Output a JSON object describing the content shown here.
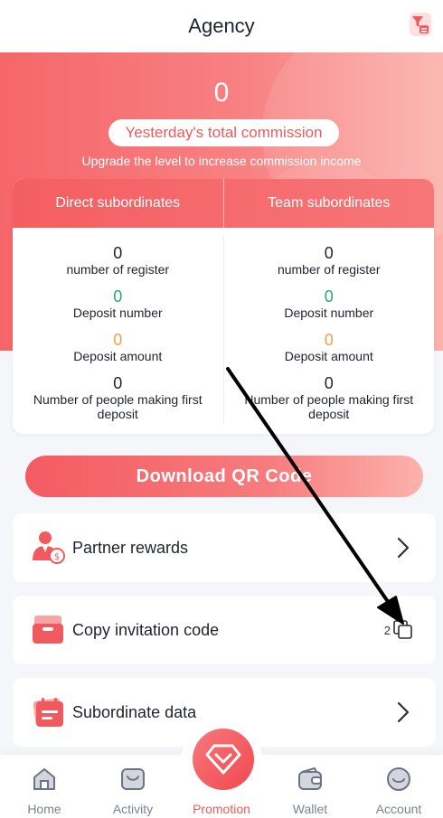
{
  "header": {
    "title": "Agency"
  },
  "hero": {
    "commission_value": "0",
    "commission_label": "Yesterday's total commission",
    "upgrade_text": "Upgrade the level to increase commission income"
  },
  "stats": {
    "direct": {
      "title": "Direct subordinates",
      "register_value": "0",
      "register_label": "number of register",
      "deposit_number_value": "0",
      "deposit_number_label": "Deposit number",
      "deposit_amount_value": "0",
      "deposit_amount_label": "Deposit amount",
      "first_deposit_value": "0",
      "first_deposit_label": "Number of people making first deposit"
    },
    "team": {
      "title": "Team subordinates",
      "register_value": "0",
      "register_label": "number of register",
      "deposit_number_value": "0",
      "deposit_number_label": "Deposit number",
      "deposit_amount_value": "0",
      "deposit_amount_label": "Deposit amount",
      "first_deposit_value": "0",
      "first_deposit_label": "Number of people making first deposit"
    }
  },
  "download_button": "Download QR Code",
  "menu": {
    "partner_rewards": "Partner rewards",
    "copy_invitation": "Copy invitation code",
    "copy_code_digit": "2",
    "subordinate_data": "Subordinate data"
  },
  "tabbar": {
    "home": "Home",
    "activity": "Activity",
    "promotion": "Promotion",
    "wallet": "Wallet",
    "account": "Account"
  },
  "colors": {
    "accent": "#f05a5f",
    "green": "#1fae71",
    "orange": "#f3a052",
    "background": "#f5f6fa"
  },
  "icons": {
    "header": "filter-icon",
    "partner": "partner-person-icon",
    "invite": "invite-box-icon",
    "subordinate": "calendar-list-icon",
    "copy": "copy-icon",
    "chevron": "chevron-right-icon"
  }
}
